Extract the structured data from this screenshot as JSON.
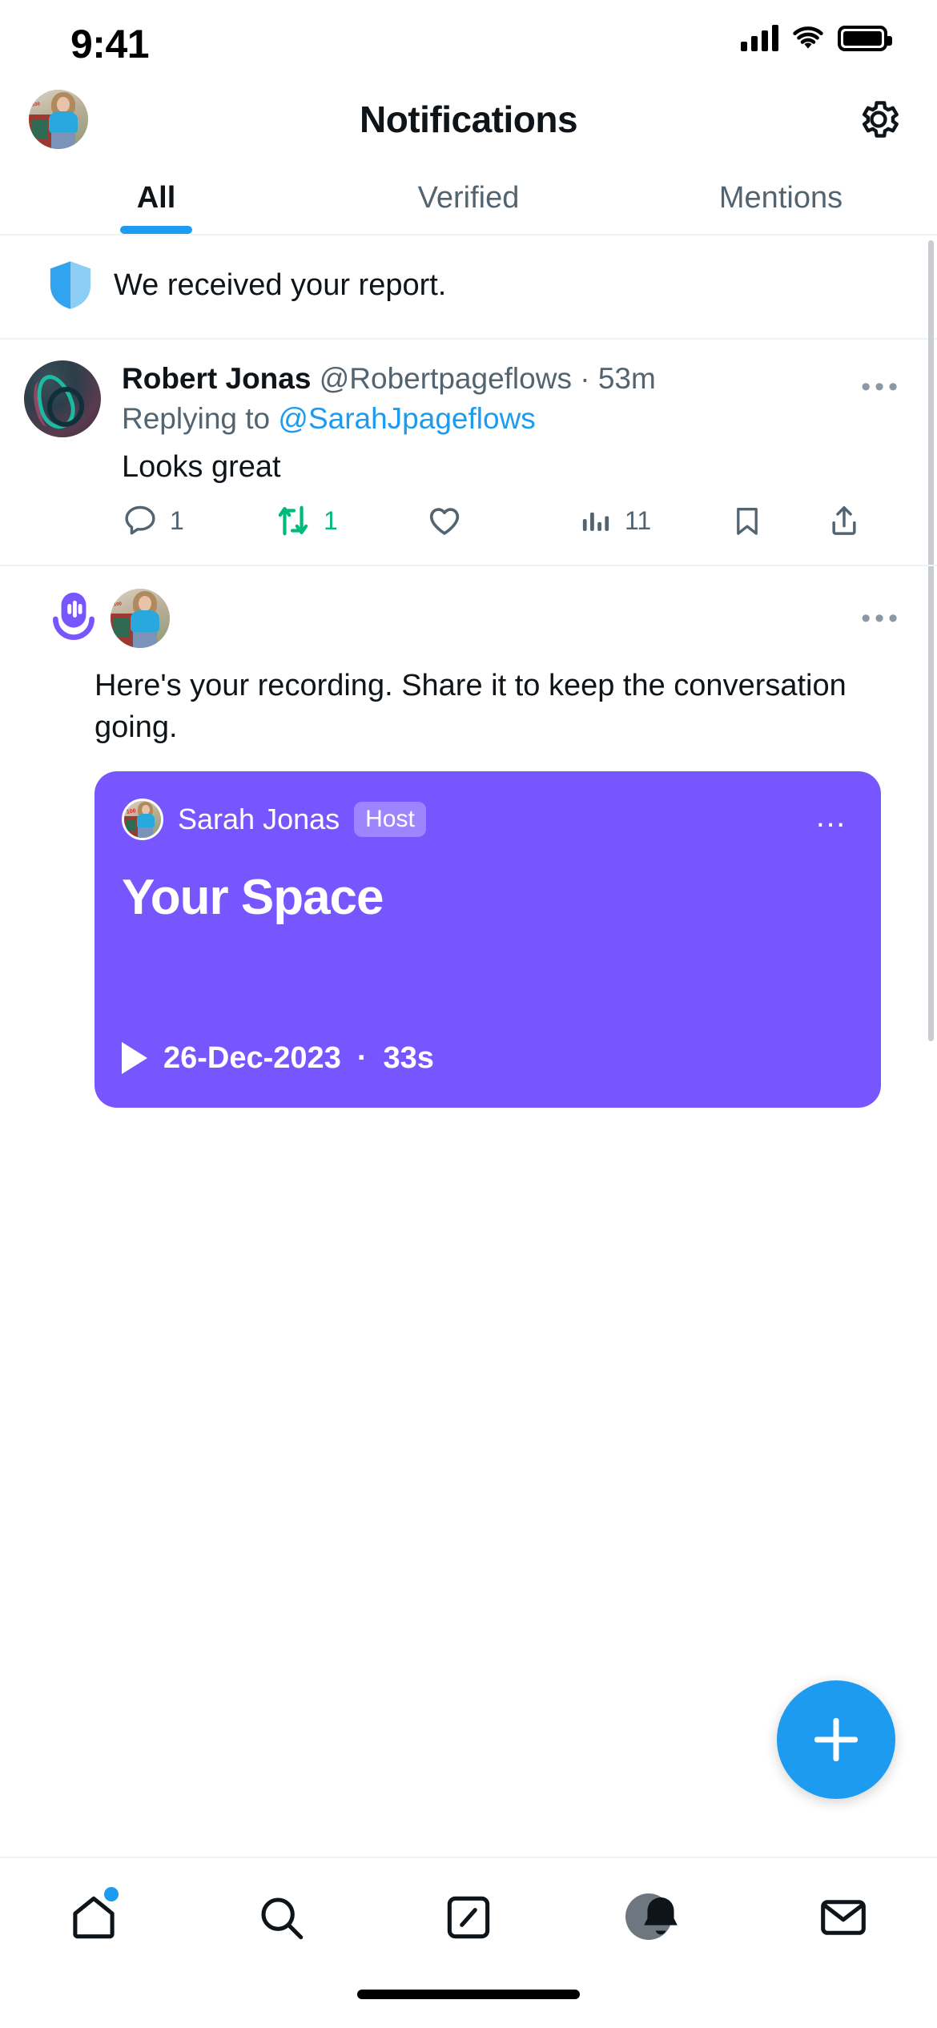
{
  "status_bar": {
    "time": "9:41",
    "cellular_icon": "signal-bars-icon",
    "wifi_icon": "wifi-icon",
    "battery_icon": "battery-full-icon"
  },
  "header": {
    "title": "Notifications",
    "avatar_name": "user-avatar",
    "settings_icon": "gear-icon"
  },
  "tabs": [
    {
      "label": "All",
      "active": true
    },
    {
      "label": "Verified",
      "active": false
    },
    {
      "label": "Mentions",
      "active": false
    }
  ],
  "notifications": {
    "report": {
      "icon": "shield-icon",
      "text": "We received your report."
    },
    "tweet": {
      "display_name": "Robert Jonas",
      "handle": "@Robertpageflows",
      "separator": "·",
      "timestamp": "53m",
      "replying_to_label": "Replying to",
      "replying_to_handle": "@SarahJpageflows",
      "body": "Looks great",
      "more_icon": "•••",
      "actions": {
        "reply_count": "1",
        "retweet_count": "1",
        "like_count": "",
        "views_count": "11",
        "bookmark_count": "",
        "share_count": ""
      }
    },
    "space": {
      "icon": "spaces-microphone-icon",
      "avatar_name": "user-avatar",
      "message": "Here's your recording. Share it to keep the conversation going.",
      "card": {
        "host_name": "Sarah Jonas",
        "host_badge": "Host",
        "title": "Your Space",
        "date": "26-Dec-2023",
        "separator": "·",
        "duration": "33s",
        "more_icon": "…",
        "play_icon": "play-icon",
        "background_color": "#7856ff"
      }
    }
  },
  "compose_button": {
    "icon": "plus-icon",
    "color": "#1d9bf0"
  },
  "bottom_nav": [
    {
      "name": "home",
      "icon": "home-icon",
      "active": false,
      "badge": true
    },
    {
      "name": "search",
      "icon": "search-icon",
      "active": false,
      "badge": false
    },
    {
      "name": "grok",
      "icon": "slash-square-icon",
      "active": false,
      "badge": false
    },
    {
      "name": "notifications",
      "icon": "bell-icon",
      "active": true,
      "badge": false
    },
    {
      "name": "messages",
      "icon": "mail-icon",
      "active": false,
      "badge": false
    }
  ],
  "colors": {
    "accent": "#1d9bf0",
    "retweet_green": "#00ba7c",
    "muted_text": "#536471",
    "space_purple": "#7856ff"
  }
}
